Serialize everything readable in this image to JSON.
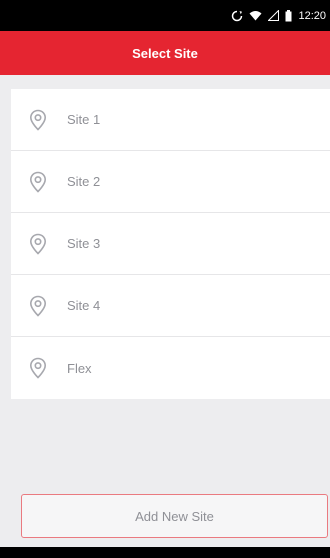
{
  "status_bar": {
    "time": "12:20",
    "icons": [
      "sync-icon",
      "wifi-icon",
      "signal-icon",
      "battery-icon"
    ]
  },
  "header": {
    "title": "Select Site"
  },
  "sites": {
    "items": [
      {
        "label": "Site 1",
        "icon": "location-pin-icon"
      },
      {
        "label": "Site 2",
        "icon": "location-pin-icon"
      },
      {
        "label": "Site 3",
        "icon": "location-pin-icon"
      },
      {
        "label": "Site 4",
        "icon": "location-pin-icon"
      },
      {
        "label": "Flex",
        "icon": "location-pin-icon"
      }
    ]
  },
  "footer": {
    "add_label": "Add New Site"
  },
  "colors": {
    "accent": "#e52531",
    "background": "#ededef",
    "text_muted": "#8f9096",
    "button_border": "#ea7a80"
  }
}
